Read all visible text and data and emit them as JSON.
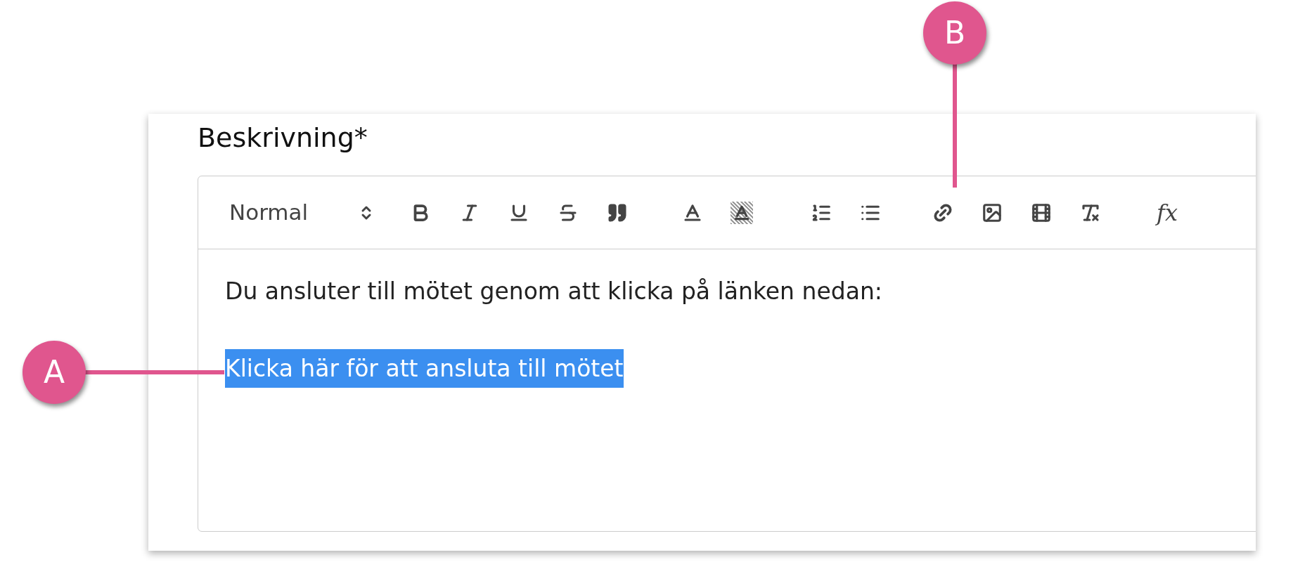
{
  "field": {
    "label": "Beskrivning*"
  },
  "toolbar": {
    "format_picker": "Normal",
    "formula_button": "fx"
  },
  "editor": {
    "paragraphs": [
      {
        "text": "Du ansluter till mötet genom att klicka på länken nedan:",
        "selected": false
      },
      {
        "text": "Klicka här för att ansluta till mötet",
        "selected": true
      }
    ]
  },
  "callouts": [
    {
      "label": "A"
    },
    {
      "label": "B"
    }
  ]
}
